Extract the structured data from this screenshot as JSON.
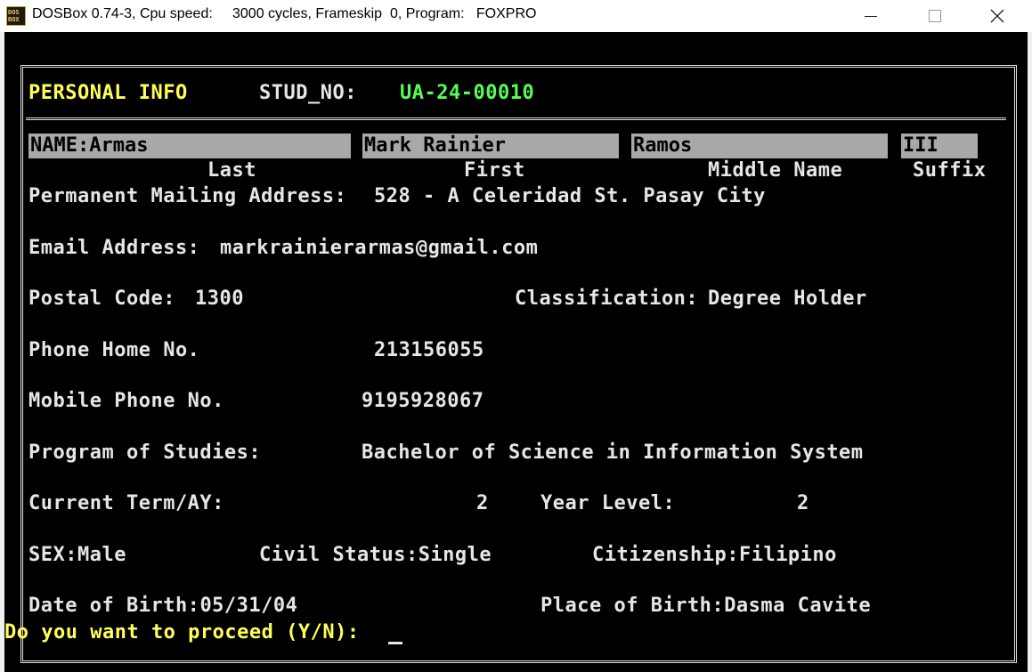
{
  "window": {
    "icon_text": "DOS BOX",
    "title": "DOSBox 0.74-3, Cpu speed:     3000 cycles, Frameskip  0, Program:   FOXPRO",
    "minimize_icon": "minimize-icon",
    "maximize_icon": "maximize-icon",
    "close_icon": "close-icon"
  },
  "header": {
    "section_title": "PERSONAL INFO",
    "stud_no_label": "STUD_NO:",
    "stud_no_value": "UA-24-00010"
  },
  "name": {
    "label": "NAME:",
    "last": "Armas",
    "first": "Mark Rainier",
    "middle": "Ramos",
    "suffix": "III",
    "caption_last": "Last",
    "caption_first": "First",
    "caption_middle": "Middle Name",
    "caption_suffix": "Suffix"
  },
  "address": {
    "label": "Permanent Mailing Address:",
    "value": "528 - A Celeridad St. Pasay City"
  },
  "email": {
    "label": "Email Address:",
    "value": "markrainierarmas@gmail.com"
  },
  "postal": {
    "label": "Postal Code:",
    "value": "1300"
  },
  "classification": {
    "label": "Classification:",
    "value": "Degree Holder"
  },
  "phone_home": {
    "label": "Phone Home No.",
    "value": "213156055"
  },
  "mobile": {
    "label": "Mobile Phone No.",
    "value": "9195928067"
  },
  "program": {
    "label": "Program of Studies:",
    "value": "Bachelor of Science in Information System"
  },
  "term": {
    "label": "Current Term/AY:",
    "value": "2"
  },
  "year_level": {
    "label": "Year Level:",
    "value": "2"
  },
  "sex": {
    "label": "SEX:",
    "value": "Male"
  },
  "civil_status": {
    "label": "Civil Status:",
    "value": "Single"
  },
  "citizenship": {
    "label": "Citizenship:",
    "value": "Filipino"
  },
  "birth_date": {
    "label": "Date of Birth:",
    "value": "05/31/04"
  },
  "birth_place": {
    "label": "Place of Birth:",
    "value": "Dasma Cavite"
  },
  "prompt": {
    "text": "Do you want to proceed (Y/N):"
  },
  "colors": {
    "prompt_yellow": "#ffff55",
    "stud_no_green": "#55ff55",
    "field_bg": "#a8a8a8",
    "screen_bg": "#000000"
  }
}
